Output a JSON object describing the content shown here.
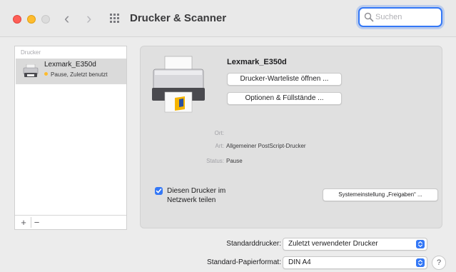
{
  "window": {
    "title": "Drucker & Scanner"
  },
  "toolbar": {
    "back_glyph": "‹",
    "forward_glyph": "›",
    "search": {
      "value": "",
      "placeholder": "Suchen"
    }
  },
  "sidebar": {
    "header": "Drucker",
    "items": [
      {
        "name": "Lexmark_E350d",
        "status": "Pause, Zuletzt benutzt",
        "status_color": "#febc2e",
        "icon": "printer-icon"
      }
    ],
    "add_label": "+",
    "remove_label": "−"
  },
  "detail": {
    "printer_name": "Lexmark_E350d",
    "open_queue_label": "Drucker-Warteliste öffnen ...",
    "options_label": "Optionen & Füllstände ...",
    "info": [
      {
        "label": "Ort:",
        "value": ""
      },
      {
        "label": "Art:",
        "value": "Allgemeiner PostScript-Drucker"
      },
      {
        "label": "Status:",
        "value": "Pause"
      }
    ],
    "share_checkbox_checked": true,
    "share_label": "Diesen Drucker im Netzwerk teilen",
    "sharing_prefs_label": "Systemeinstellung „Freigaben“ ..."
  },
  "footer": {
    "default_printer_label": "Standarddrucker:",
    "default_printer_value": "Zuletzt verwendeter Drucker",
    "paper_size_label": "Standard-Papierformat:",
    "paper_size_value": "DIN A4",
    "help_label": "?"
  },
  "colors": {
    "accent": "#3478f6",
    "close": "#fe5f57",
    "minimize": "#febc2e",
    "zoom_inactive": "#dcdcdc"
  }
}
